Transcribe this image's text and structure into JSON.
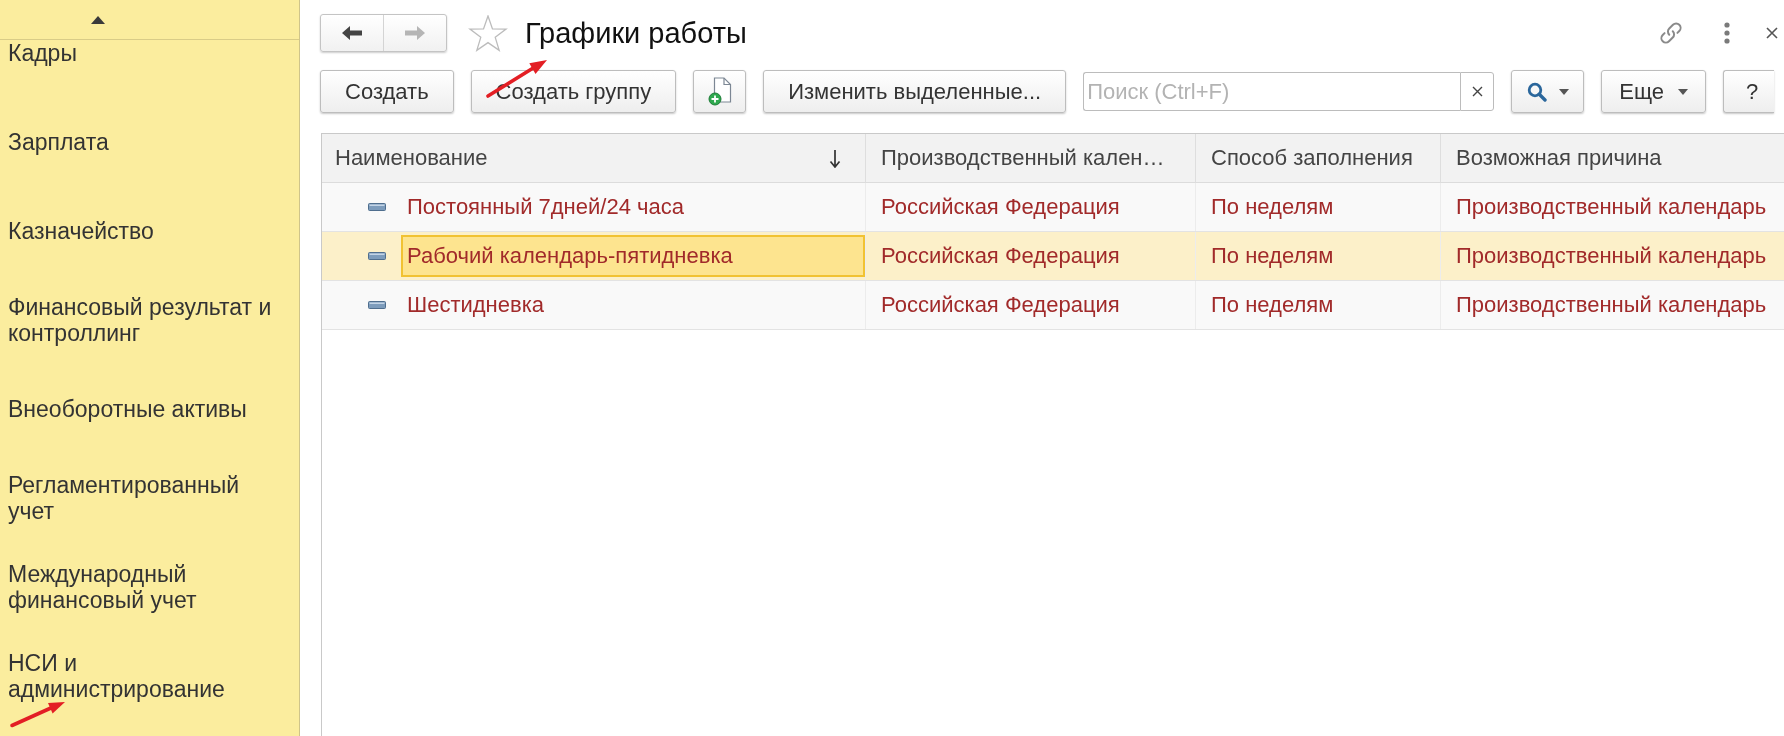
{
  "sidebar": {
    "items": [
      {
        "label": "Кадры",
        "selected": false
      },
      {
        "label": "Зарплата",
        "selected": false
      },
      {
        "label": "Казначейство",
        "selected": false
      },
      {
        "label": "Финансовый результат и контроллинг",
        "selected": false
      },
      {
        "label": "Внеоборотные активы",
        "selected": false
      },
      {
        "label": "Регламентированный учет",
        "selected": false
      },
      {
        "label": "Международный финансовый учет",
        "selected": false
      },
      {
        "label": "НСИ и администрирование",
        "selected": false
      }
    ]
  },
  "navigation": {
    "back": {
      "disabled": false
    },
    "forward": {
      "disabled": true
    }
  },
  "window": {
    "title": "Графики работы",
    "favorite": false
  },
  "toolbar": {
    "buttons": [
      {
        "kind": "text",
        "label": "Создать"
      },
      {
        "kind": "text",
        "label": "Создать группу"
      },
      {
        "kind": "add-document"
      },
      {
        "kind": "text",
        "label": "Изменить выделенные..."
      }
    ],
    "search": {
      "placeholder": "Поиск (Ctrl+F)"
    },
    "more_button": {
      "label": "Еще"
    },
    "help_button": {
      "label": "?"
    }
  },
  "table": {
    "columns": [
      {
        "label": "Наименование",
        "sorted": true
      },
      {
        "label": "Производственный кален…",
        "sorted": false
      },
      {
        "label": "Способ заполнения",
        "sorted": false
      },
      {
        "label": "Возможная причина",
        "sorted": false
      }
    ],
    "rows": [
      {
        "selected": false,
        "cells": [
          "Постоянный 7дней/24 часа",
          "Российская Федерация",
          "По неделям",
          "Производственный календарь"
        ]
      },
      {
        "selected": true,
        "cells": [
          "Рабочий календарь-пятидневка",
          "Российская Федерация",
          "По неделям",
          "Производственный календарь"
        ]
      },
      {
        "selected": false,
        "cells": [
          "Шестидневка",
          "Российская Федерация",
          "По неделям",
          "Производственный календарь"
        ]
      }
    ]
  }
}
